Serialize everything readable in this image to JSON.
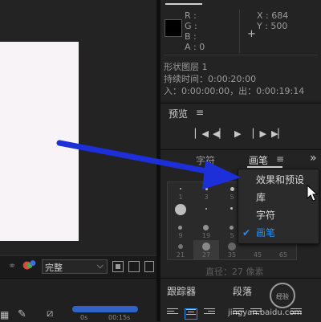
{
  "info_panel": {
    "r_label": "R :",
    "g_label": "G :",
    "b_label": "B :",
    "a_label": "A : 0",
    "x_label": "X : 684",
    "y_label": "Y : 500",
    "layer_name": "形状图层 1",
    "duration": "持续时间：0:00:20:00",
    "in_out": "入：0:00:00:00，出：0:00:19:14"
  },
  "preview_panel": {
    "title": "预览",
    "menu_icon": "≡",
    "buttons": [
      "first-frame-icon",
      "prev-frame-icon",
      "play-icon",
      "next-frame-icon",
      "last-frame-icon"
    ]
  },
  "brush_panel": {
    "tabs": [
      "字符",
      "画笔"
    ],
    "active_tab": "画笔",
    "menu_icon": "≡",
    "overflow_icon": "»",
    "visible_numbers": [
      "1",
      "3",
      "5",
      "9",
      "19",
      "5",
      "21",
      "27",
      "35",
      "45",
      "65"
    ],
    "status_text": "直径：27 像素"
  },
  "context_menu": {
    "items": [
      {
        "label": "效果和预设",
        "checked": false
      },
      {
        "label": "库",
        "checked": false
      },
      {
        "label": "字符",
        "checked": false
      },
      {
        "label": "画笔",
        "checked": true
      }
    ],
    "check_glyph": "✔"
  },
  "viewer_toolbar": {
    "quality_value": "完整",
    "dropdown_arrow": "⌵"
  },
  "bottom_panel": {
    "tracker_tab": "跟踪器",
    "paragraph_tab": "段落",
    "menu_icon": "≡"
  },
  "timeline": {
    "time_left": "0s",
    "time_right": "00:15s"
  },
  "watermark": {
    "text": "jingyan.baidu.com",
    "brand": "经验"
  },
  "colors": {
    "accent": "#2d8ceb",
    "arrow": "#1c2fd8",
    "canvas": "#f7f3f6",
    "panel_bg": "#232323"
  }
}
